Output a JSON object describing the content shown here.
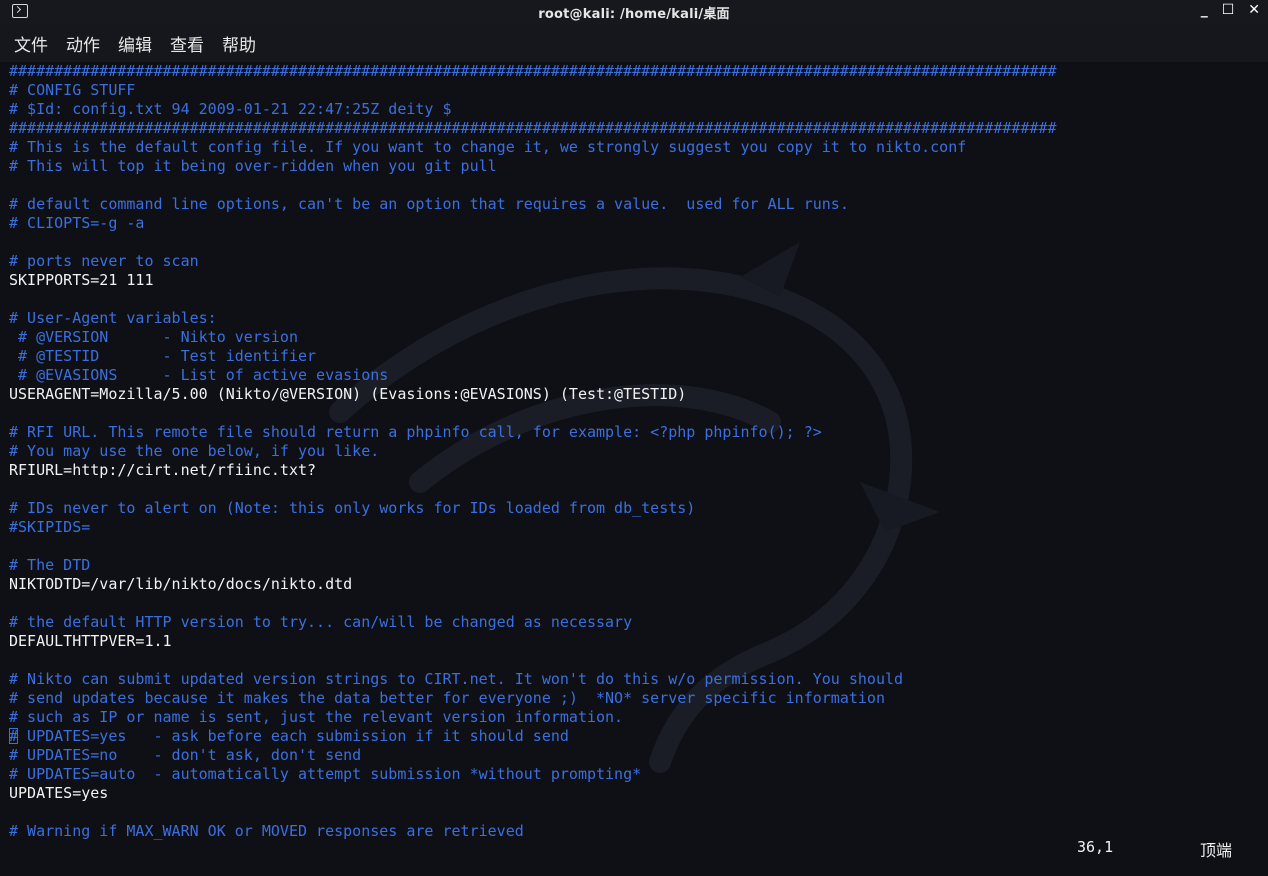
{
  "window": {
    "title": "root@kali: /home/kali/桌面",
    "minimize": "_",
    "maximize": "☐",
    "close": "✕"
  },
  "menu": [
    "文件",
    "动作",
    "编辑",
    "查看",
    "帮助"
  ],
  "lines": [
    {
      "t": "####################################################################################################################",
      "k": "c"
    },
    {
      "t": "# CONFIG STUFF",
      "k": "c"
    },
    {
      "t": "# $Id: config.txt 94 2009-01-21 22:47:25Z deity $",
      "k": "c"
    },
    {
      "t": "####################################################################################################################",
      "k": "c"
    },
    {
      "t": "# This is the default config file. If you want to change it, we strongly suggest you copy it to nikto.conf",
      "k": "c"
    },
    {
      "t": "# This will top it being over-ridden when you git pull",
      "k": "c"
    },
    {
      "t": "",
      "k": "n"
    },
    {
      "t": "# default command line options, can't be an option that requires a value.  used for ALL runs.",
      "k": "c"
    },
    {
      "t": "# CLIOPTS=-g -a",
      "k": "c"
    },
    {
      "t": "",
      "k": "n"
    },
    {
      "t": "# ports never to scan",
      "k": "c"
    },
    {
      "t": "SKIPPORTS=21 111",
      "k": "n"
    },
    {
      "t": "",
      "k": "n"
    },
    {
      "t": "# User-Agent variables:",
      "k": "c"
    },
    {
      "t": " # @VERSION      - Nikto version",
      "k": "c"
    },
    {
      "t": " # @TESTID       - Test identifier",
      "k": "c"
    },
    {
      "t": " # @EVASIONS     - List of active evasions",
      "k": "c"
    },
    {
      "t": "USERAGENT=Mozilla/5.00 (Nikto/@VERSION) (Evasions:@EVASIONS) (Test:@TESTID)",
      "k": "n"
    },
    {
      "t": "",
      "k": "n"
    },
    {
      "t": "# RFI URL. This remote file should return a phpinfo call, for example: <?php phpinfo(); ?>",
      "k": "c"
    },
    {
      "t": "# You may use the one below, if you like.",
      "k": "c"
    },
    {
      "t": "RFIURL=http://cirt.net/rfiinc.txt?",
      "k": "n"
    },
    {
      "t": "",
      "k": "n"
    },
    {
      "t": "# IDs never to alert on (Note: this only works for IDs loaded from db_tests)",
      "k": "c"
    },
    {
      "t": "#SKIPIDS=",
      "k": "c"
    },
    {
      "t": "",
      "k": "n"
    },
    {
      "t": "# The DTD",
      "k": "c"
    },
    {
      "t": "NIKTODTD=/var/lib/nikto/docs/nikto.dtd",
      "k": "n"
    },
    {
      "t": "",
      "k": "n"
    },
    {
      "t": "# the default HTTP version to try... can/will be changed as necessary",
      "k": "c"
    },
    {
      "t": "DEFAULTHTTPVER=1.1",
      "k": "n"
    },
    {
      "t": "",
      "k": "n"
    },
    {
      "t": "# Nikto can submit updated version strings to CIRT.net. It won't do this w/o permission. You should",
      "k": "c"
    },
    {
      "t": "# send updates because it makes the data better for everyone ;)  *NO* server specific information",
      "k": "c"
    },
    {
      "t": "# such as IP or name is sent, just the relevant version information.",
      "k": "c"
    },
    {
      "t": "# UPDATES=yes   - ask before each submission if it should send",
      "k": "c",
      "cursor": true
    },
    {
      "t": "# UPDATES=no    - don't ask, don't send",
      "k": "c"
    },
    {
      "t": "# UPDATES=auto  - automatically attempt submission *without prompting*",
      "k": "c"
    },
    {
      "t": "UPDATES=yes",
      "k": "n"
    },
    {
      "t": "",
      "k": "n"
    },
    {
      "t": "# Warning if MAX_WARN OK or MOVED responses are retrieved",
      "k": "c"
    }
  ],
  "status": {
    "position": "36,1",
    "scroll": "顶端"
  },
  "colors": {
    "comment": "#3b6fe0",
    "text": "#f2f2f2",
    "background": "#0e1016"
  }
}
